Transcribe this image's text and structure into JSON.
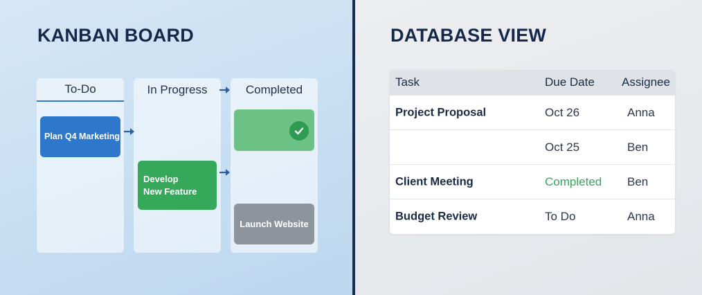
{
  "kanban": {
    "title": "KANBAN BOARD",
    "columns": [
      {
        "label": "To-Do"
      },
      {
        "label": "In Progress"
      },
      {
        "label": "Completed"
      }
    ],
    "cards": {
      "plan": "Plan Q4 Marketing",
      "develop_line1": "Develop",
      "develop_line2": "New Feature",
      "launch": "Launch Website"
    },
    "colors": {
      "todo_card": "#2e78cc",
      "progress_card": "#36a85a",
      "completed_card": "#6cc185",
      "launch_card": "#8e949c",
      "divider": "#1b2d4d"
    }
  },
  "database": {
    "title": "DATABASE VIEW",
    "headers": {
      "task": "Task",
      "due": "Due Date",
      "assignee": "Assignee"
    },
    "rows": [
      {
        "task": "Project Proposal",
        "due": "Oct 26",
        "assignee": "Anna"
      },
      {
        "task": "",
        "due": "Oct 25",
        "assignee": "Ben"
      },
      {
        "task": "Client Meeting",
        "due": "Completed",
        "assignee": "Ben"
      },
      {
        "task": "Budget Review",
        "due": "To Do",
        "assignee": "Anna"
      }
    ]
  }
}
